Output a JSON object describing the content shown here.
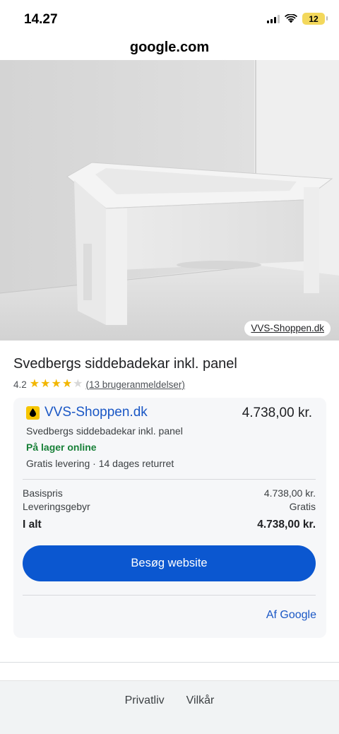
{
  "status_bar": {
    "time": "14.27",
    "battery": "12",
    "battery_color": "#f3d85c"
  },
  "browser": {
    "url": "google.com"
  },
  "hero": {
    "source_chip": "VVS-Shoppen.dk"
  },
  "product": {
    "title": "Svedbergs siddebadekar inkl. panel",
    "rating": "4.2",
    "rating_value": 4.2,
    "rating_max": 5,
    "reviews_link": "(13 brugeranmeldelser)"
  },
  "offer": {
    "seller_icon": "store-drop-icon",
    "seller": "VVS-Shoppen.dk",
    "price": "4.738,00 kr.",
    "title": "Svedbergs siddebadekar inkl. panel",
    "stock": "På lager online",
    "shipping": "Gratis levering · 14 dages returret",
    "breakdown": [
      {
        "label": "Basispris",
        "value": "4.738,00 kr."
      },
      {
        "label": "Leveringsgebyr",
        "value": "Gratis"
      }
    ],
    "total_label": "I alt",
    "total_value": "4.738,00 kr.",
    "visit_button": "Besøg website",
    "by_google": "Af Google"
  },
  "footer": {
    "privacy": "Privatliv",
    "terms": "Vilkår"
  },
  "colors": {
    "link_blue": "#1a57c5",
    "button_blue": "#0b57d0",
    "stock_green": "#188038",
    "star_gold": "#f2b600",
    "seller_icon_yellow": "#f6c500"
  }
}
